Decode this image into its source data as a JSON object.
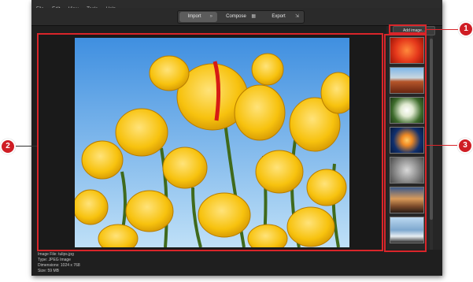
{
  "menu": [
    "File",
    "Edit",
    "View",
    "Tools",
    "Help"
  ],
  "modes": [
    {
      "label": "Import",
      "icon": "»",
      "active": true
    },
    {
      "label": "Compose",
      "icon": "▦",
      "active": false
    },
    {
      "label": "Export",
      "icon": "⇲",
      "active": false
    }
  ],
  "sidebar": {
    "add_button": "Add image...",
    "thumbnails": [
      "red-flower-thumbnail",
      "desert-thumbnail",
      "white-flower-thumbnail",
      "jellyfish-thumbnail",
      "koala-thumbnail",
      "lighthouse-thumbnail",
      "penguins-thumbnail"
    ]
  },
  "info": {
    "file": "Image File: tulips.jpg",
    "type": "Type: JPEG Image",
    "dimensions": "Dimensions: 1024 x 768",
    "size": "Size: 59 MB"
  },
  "callouts": {
    "c1": "1",
    "c2": "2",
    "c3": "3"
  },
  "colors": {
    "callout_red": "#d9252a",
    "window_bg": "#1f1f1f"
  }
}
